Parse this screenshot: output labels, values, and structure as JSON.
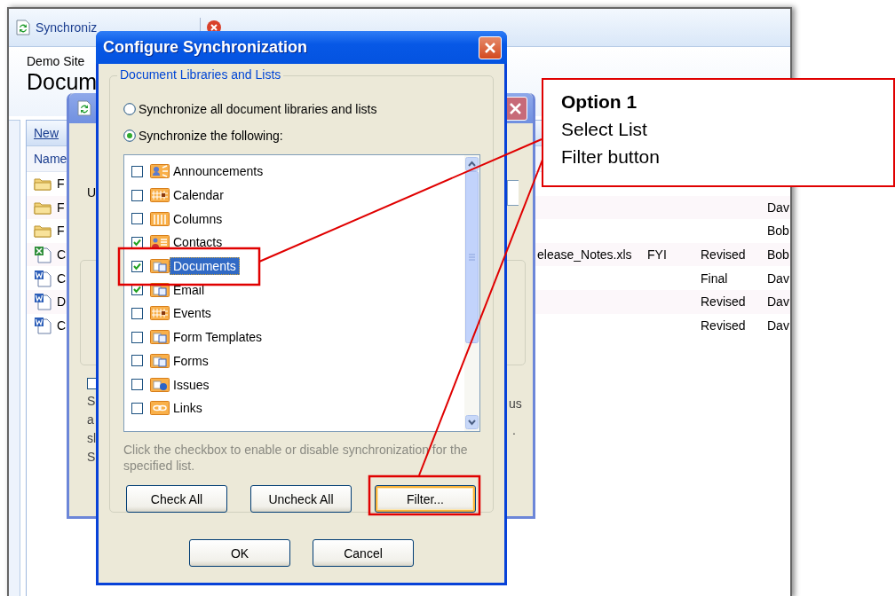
{
  "app_window": {
    "sync_button": {
      "label": "Synchroniz"
    },
    "site": "Demo Site",
    "page_title": "Docum",
    "new_button": {
      "label": "New"
    },
    "name_column": "Name",
    "rows": [
      {
        "kind": "folder",
        "name": "F"
      },
      {
        "kind": "folder",
        "name": "F",
        "column_5": "Dav"
      },
      {
        "kind": "folder",
        "name": "F",
        "column_5": "Bob"
      },
      {
        "kind": "spreadsheet",
        "name": "C",
        "column_2": "elease_Notes.xls",
        "column_3": "FYI",
        "column_4": "Revised",
        "column_5": "Bob"
      },
      {
        "kind": "document",
        "name": "C",
        "column_4": "Final",
        "column_5": "Dav"
      },
      {
        "kind": "document",
        "name": "D",
        "column_4": "Revised",
        "column_5": "Dav"
      },
      {
        "kind": "document",
        "name": "C",
        "column_4": "Revised",
        "column_5": "Dav"
      }
    ]
  },
  "back_dialog": {
    "label_fragment": "U",
    "checkbox": {
      "checked": false
    },
    "left_fragments": [
      "S",
      "a",
      "sl",
      "S"
    ],
    "right_fragments": [
      "us",
      "."
    ]
  },
  "dialog": {
    "title": "Configure Synchronization",
    "group_title": "Document Libraries and Lists",
    "options": [
      {
        "label": "Synchronize all document libraries and lists",
        "selected": false
      },
      {
        "label": "Synchronize the following:",
        "selected": true
      }
    ],
    "lists": [
      {
        "kind": "announcements",
        "label": "Announcements",
        "checked": false,
        "selected": false
      },
      {
        "kind": "calendar",
        "label": "Calendar",
        "checked": false,
        "selected": false
      },
      {
        "kind": "columns",
        "label": "Columns",
        "checked": false,
        "selected": false
      },
      {
        "kind": "contacts",
        "label": "Contacts",
        "checked": true,
        "selected": false
      },
      {
        "kind": "library",
        "label": "Documents",
        "checked": true,
        "selected": true
      },
      {
        "kind": "library",
        "label": "Email",
        "checked": true,
        "selected": false
      },
      {
        "kind": "calendar",
        "label": "Events",
        "checked": false,
        "selected": false
      },
      {
        "kind": "library",
        "label": "Form Templates",
        "checked": false,
        "selected": false
      },
      {
        "kind": "library",
        "label": "Forms",
        "checked": false,
        "selected": false
      },
      {
        "kind": "issues",
        "label": "Issues",
        "checked": false,
        "selected": false
      },
      {
        "kind": "links",
        "label": "Links",
        "checked": false,
        "selected": false
      }
    ],
    "hint": "Click the checkbox to enable or disable synchronization for the specified list.",
    "list_buttons": [
      {
        "label": "Check All",
        "focused": false
      },
      {
        "label": "Uncheck All",
        "focused": false
      },
      {
        "label": "Filter...",
        "focused": true
      }
    ],
    "buttons": [
      "OK",
      "Cancel"
    ]
  },
  "callout": {
    "title": "Option 1",
    "lines": [
      "Select List",
      "Filter button"
    ]
  }
}
